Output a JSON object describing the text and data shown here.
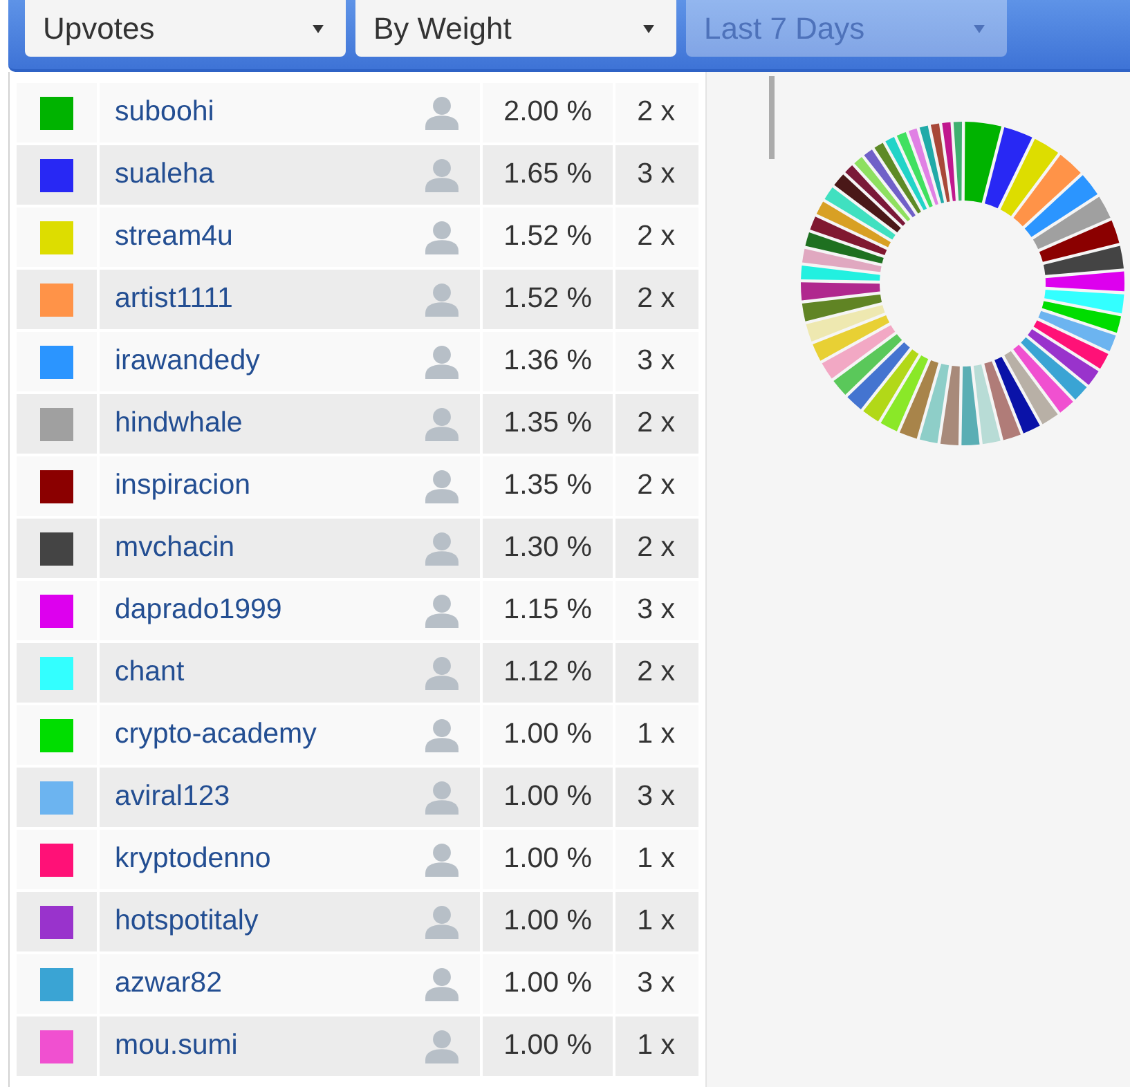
{
  "filters": [
    {
      "value": "Upvotes",
      "disabled": false
    },
    {
      "value": "By Weight",
      "disabled": false
    },
    {
      "value": "Last 7 Days",
      "disabled": true
    }
  ],
  "voters": [
    {
      "color": "#00b300",
      "name": "suboohi",
      "weight": "2.00 %",
      "count": "2 x"
    },
    {
      "color": "#2828f4",
      "name": "sualeha",
      "weight": "1.65 %",
      "count": "3 x"
    },
    {
      "color": "#dddd00",
      "name": "stream4u",
      "weight": "1.52 %",
      "count": "2 x"
    },
    {
      "color": "#ff9348",
      "name": "artist1111",
      "weight": "1.52 %",
      "count": "2 x"
    },
    {
      "color": "#2b95ff",
      "name": "irawandedy",
      "weight": "1.36 %",
      "count": "3 x"
    },
    {
      "color": "#a0a0a0",
      "name": "hindwhale",
      "weight": "1.35 %",
      "count": "2 x"
    },
    {
      "color": "#8b0000",
      "name": "inspiracion",
      "weight": "1.35 %",
      "count": "2 x"
    },
    {
      "color": "#444444",
      "name": "mvchacin",
      "weight": "1.30 %",
      "count": "2 x"
    },
    {
      "color": "#dd00ee",
      "name": "daprado1999",
      "weight": "1.15 %",
      "count": "3 x"
    },
    {
      "color": "#33ffff",
      "name": "chant",
      "weight": "1.12 %",
      "count": "2 x"
    },
    {
      "color": "#00dd00",
      "name": "crypto-academy",
      "weight": "1.00 %",
      "count": "1 x"
    },
    {
      "color": "#6cb4f0",
      "name": "aviral123",
      "weight": "1.00 %",
      "count": "3 x"
    },
    {
      "color": "#ff1177",
      "name": "kryptodenno",
      "weight": "1.00 %",
      "count": "1 x"
    },
    {
      "color": "#9933cc",
      "name": "hotspotitaly",
      "weight": "1.00 %",
      "count": "1 x"
    },
    {
      "color": "#3aa4d4",
      "name": "azwar82",
      "weight": "1.00 %",
      "count": "3 x"
    },
    {
      "color": "#f050d0",
      "name": "mou.sumi",
      "weight": "1.00 %",
      "count": "1 x"
    }
  ]
}
